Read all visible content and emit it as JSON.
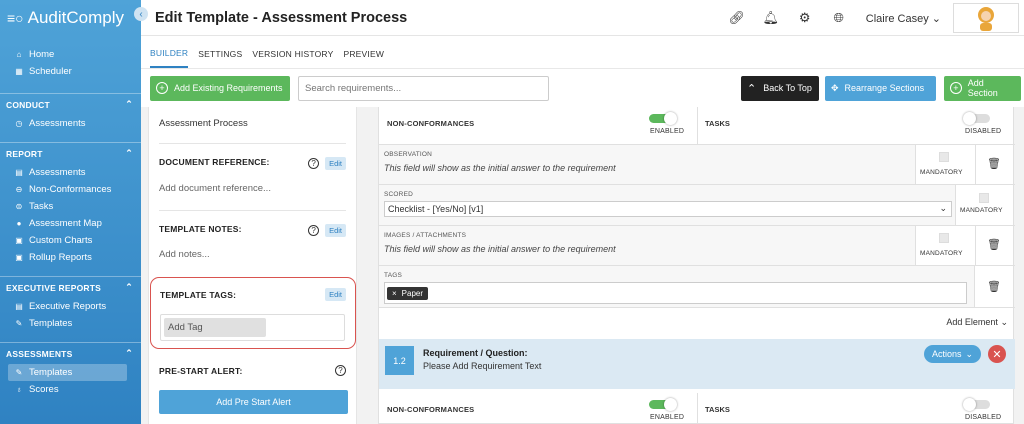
{
  "app": {
    "name": "AuditComply"
  },
  "sidebar": {
    "top_items": [
      {
        "label": "Home",
        "icon": "home-icon"
      },
      {
        "label": "Scheduler",
        "icon": "calendar-icon"
      }
    ],
    "sections": [
      {
        "title": "CONDUCT",
        "items": [
          {
            "label": "Assessments"
          }
        ]
      },
      {
        "title": "REPORT",
        "items": [
          {
            "label": "Assessments"
          },
          {
            "label": "Non-Conformances"
          },
          {
            "label": "Tasks"
          },
          {
            "label": "Assessment Map"
          },
          {
            "label": "Custom Charts"
          },
          {
            "label": "Rollup Reports"
          }
        ]
      },
      {
        "title": "EXECUTIVE REPORTS",
        "items": [
          {
            "label": "Executive Reports"
          },
          {
            "label": "Templates"
          }
        ]
      },
      {
        "title": "ASSESSMENTS",
        "items": [
          {
            "label": "Templates"
          },
          {
            "label": "Scores"
          }
        ]
      }
    ]
  },
  "header": {
    "title": "Edit Template - Assessment Process",
    "user_name": "Claire Casey"
  },
  "tabs": [
    {
      "label": "BUILDER"
    },
    {
      "label": "SETTINGS"
    },
    {
      "label": "VERSION HISTORY"
    },
    {
      "label": "PREVIEW"
    }
  ],
  "toolbar": {
    "add_existing": "Add Existing Requirements",
    "search_placeholder": "Search requirements...",
    "back_to_top": "Back To Top",
    "rearrange": "Rearrange Sections",
    "add_section": "Add Section"
  },
  "left_panel": {
    "template_name": "Assessment Process",
    "doc_ref_label": "DOCUMENT REFERENCE:",
    "doc_ref_placeholder": "Add document reference...",
    "notes_label": "TEMPLATE NOTES:",
    "notes_placeholder": "Add notes...",
    "tags_label": "TEMPLATE TAGS:",
    "add_tag_placeholder": "Add Tag",
    "prestart_label": "PRE-START ALERT:",
    "prestart_button": "Add Pre Start Alert",
    "edit_label": "Edit",
    "help_glyph": "?"
  },
  "requirement": {
    "nonconformances_label": "NON-CONFORMANCES",
    "enabled_label": "ENABLED",
    "tasks_label": "TASKS",
    "disabled_label": "DISABLED",
    "nonconformances_enabled": true,
    "tasks_enabled": false,
    "fields": [
      {
        "label": "OBSERVATION",
        "desc": "This field will show as the initial answer to the requirement"
      },
      {
        "label": "SCORED",
        "value": "Checklist - [Yes/No] [v1]"
      },
      {
        "label": "IMAGES / ATTACHMENTS",
        "desc": "This field will show as the initial answer to the requirement"
      },
      {
        "label": "TAGS",
        "tags": [
          "Paper"
        ]
      }
    ],
    "mandatory_label": "MANDATORY",
    "add_element": "Add Element",
    "next": {
      "number": "1.2",
      "title": "Requirement / Question:",
      "text": "Please Add Requirement Text",
      "actions": "Actions"
    }
  },
  "colors": {
    "sidebar": "#3a8fcc",
    "accent": "#4fa3d8",
    "green": "#5cb85c",
    "danger": "#d9534f"
  }
}
